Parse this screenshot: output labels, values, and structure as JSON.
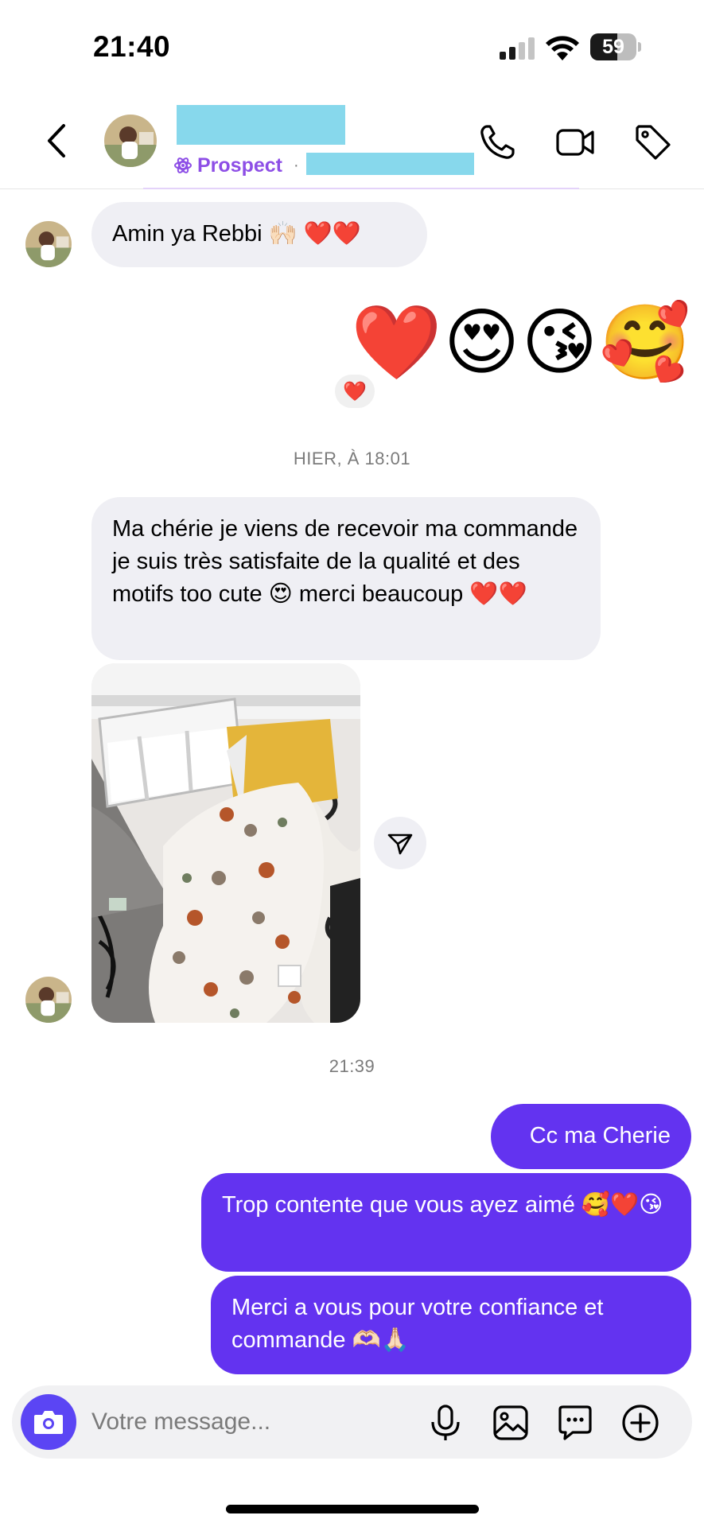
{
  "status_bar": {
    "time": "21:40",
    "battery": "59",
    "battery_level": 0.59
  },
  "header": {
    "tag_label": "Prospect",
    "separator": "·"
  },
  "messages": {
    "m1_text": "Amin ya Rebbi 🙌🏻 ❤️❤️",
    "m2_emojis": "❤️😍😘🥰",
    "m2_reaction": "❤️",
    "timestamp1": "HIER, À 18:01",
    "m3_text": "Ma chérie je viens de recevoir ma commande je suis très satisfaite de la qualité et des motifs too cute 😍 merci beaucoup ❤️❤️",
    "timestamp2": "21:39",
    "m4_text": "Cc ma Cherie",
    "m5_text": "Trop contente que vous ayez aimé 🥰❤️😘",
    "m6_text": "Merci a vous pour votre confiance et commande 🫶🏻🙏🏻"
  },
  "composer": {
    "placeholder": "Votre message..."
  },
  "icons": {
    "back": "chevron-left-icon",
    "call": "phone-icon",
    "video": "video-camera-icon",
    "tag": "tag-icon",
    "share": "paper-plane-icon",
    "camera": "camera-icon",
    "mic": "microphone-icon",
    "gallery": "image-icon",
    "quick_reply": "chat-bubble-icon",
    "plus": "plus-circle-icon"
  },
  "colors": {
    "outgoing_bubble": "#6333f0",
    "incoming_bubble": "#efeff4",
    "accent": "#5b45f4",
    "prospect": "#8d4ee6",
    "redaction": "#87d8ec"
  }
}
